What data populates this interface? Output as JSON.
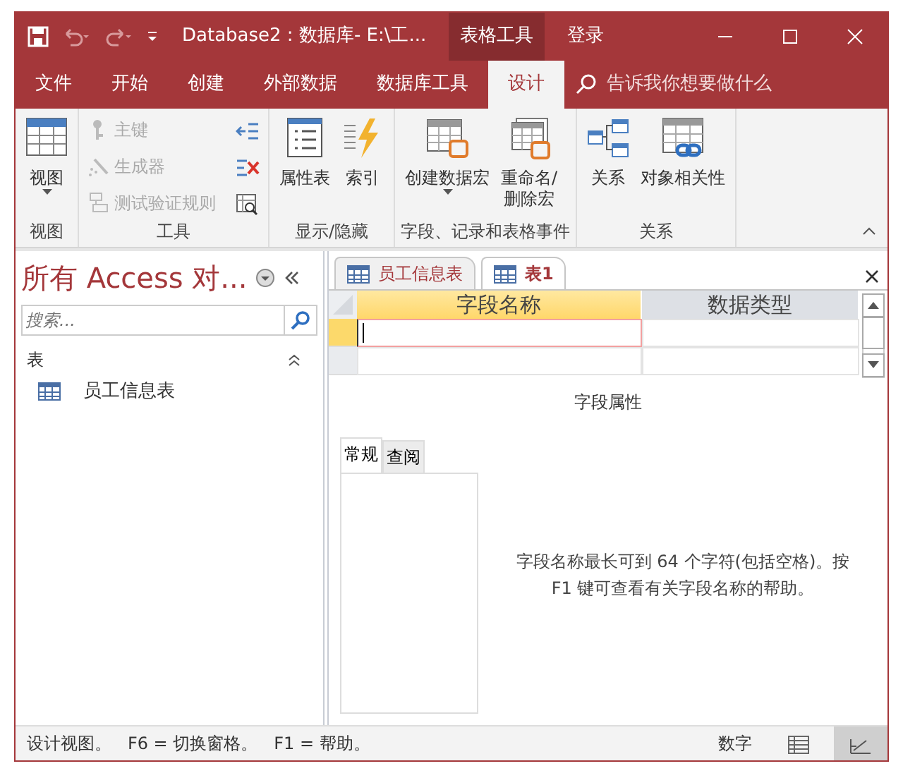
{
  "window": {
    "title": "Database2 : 数据库- E:\\工...",
    "contextual_tab": "表格工具",
    "sign_in": "登录"
  },
  "ribbon_tabs": [
    {
      "label": "文件",
      "selected": false
    },
    {
      "label": "开始",
      "selected": false
    },
    {
      "label": "创建",
      "selected": false
    },
    {
      "label": "外部数据",
      "selected": false
    },
    {
      "label": "数据库工具",
      "selected": false
    },
    {
      "label": "设计",
      "selected": true
    }
  ],
  "tell_me": {
    "placeholder": "告诉我你想要做什么"
  },
  "ribbon_groups": [
    {
      "label": "视图",
      "buttons": [
        {
          "label": "视图",
          "kind": "large",
          "dropdown": true,
          "disabled": false
        }
      ]
    },
    {
      "label": "工具",
      "buttons": [
        {
          "label": "主键",
          "kind": "small",
          "disabled": true
        },
        {
          "label": "生成器",
          "kind": "small",
          "disabled": true
        },
        {
          "label": "测试验证规则",
          "kind": "small",
          "disabled": true
        }
      ]
    },
    {
      "label": "显示/隐藏",
      "buttons": [
        {
          "label": "属性表",
          "kind": "large",
          "dropdown": false,
          "disabled": false
        },
        {
          "label": "索引",
          "kind": "large",
          "dropdown": false,
          "disabled": false
        }
      ]
    },
    {
      "label": "字段、记录和表格事件",
      "buttons": [
        {
          "label": "创建数据宏",
          "kind": "large",
          "dropdown": true,
          "disabled": false
        },
        {
          "label": "重命名/\n删除宏",
          "kind": "large",
          "dropdown": false,
          "disabled": false
        }
      ]
    },
    {
      "label": "关系",
      "buttons": [
        {
          "label": "关系",
          "kind": "large",
          "dropdown": false,
          "disabled": false
        },
        {
          "label": "对象相关性",
          "kind": "large",
          "dropdown": false,
          "disabled": false
        }
      ]
    }
  ],
  "nav_pane": {
    "title": "所有 Access 对...",
    "search": {
      "placeholder": "搜索..."
    },
    "section": "表",
    "items": [
      "员工信息表"
    ]
  },
  "doc_tabs": [
    {
      "label": "员工信息表",
      "selected": false
    },
    {
      "label": "表1",
      "selected": true
    }
  ],
  "grid": {
    "columns": [
      {
        "label": "字段名称",
        "selected": true
      },
      {
        "label": "数据类型",
        "selected": false
      }
    ]
  },
  "field_properties": {
    "title": "字段属性",
    "tabs": [
      {
        "label": "常规",
        "selected": true
      },
      {
        "label": "查阅",
        "selected": false
      }
    ],
    "help": "字段名称最长可到 64 个字符(包括空格)。按 F1 键可查看有关字段名称的帮助。"
  },
  "status_bar": {
    "text": "设计视图。   F6 = 切换窗格。   F1 = 帮助。",
    "mode": "数字"
  }
}
